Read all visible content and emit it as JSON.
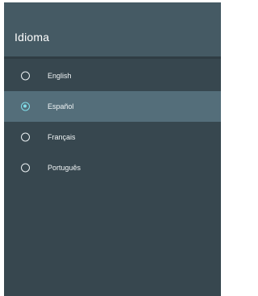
{
  "title": "Idioma",
  "languages": [
    {
      "label": "English",
      "selected": false
    },
    {
      "label": "Español",
      "selected": true
    },
    {
      "label": "Français",
      "selected": false
    },
    {
      "label": "Português",
      "selected": false
    }
  ],
  "colors": {
    "background": "#37474f",
    "header": "#455a64",
    "selected_row": "#546e7a",
    "accent": "#80deea"
  }
}
